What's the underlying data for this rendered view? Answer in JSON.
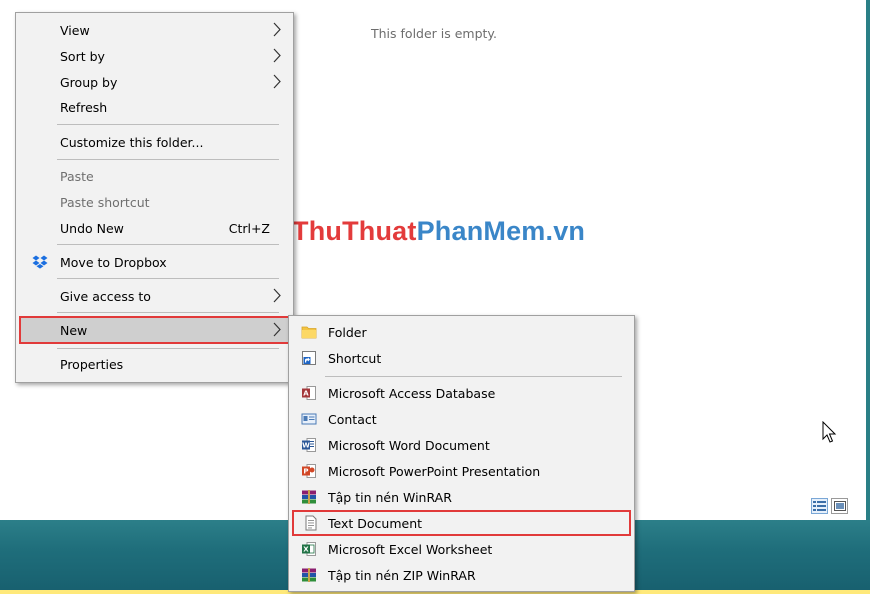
{
  "explorer": {
    "empty_message": "This folder is empty."
  },
  "watermark": {
    "part1": "ThuThuat",
    "part2": "PhanMem",
    "part3": ".vn"
  },
  "context_menu": {
    "items": [
      {
        "label": "View",
        "has_submenu": true
      },
      {
        "label": "Sort by",
        "has_submenu": true
      },
      {
        "label": "Group by",
        "has_submenu": true
      },
      {
        "label": "Refresh"
      },
      {
        "label": "Customize this folder..."
      },
      {
        "label": "Paste",
        "disabled": true
      },
      {
        "label": "Paste shortcut",
        "disabled": true
      },
      {
        "label": "Undo New",
        "shortcut": "Ctrl+Z"
      },
      {
        "label": "Move to Dropbox",
        "icon": "dropbox-icon"
      },
      {
        "label": "Give access to",
        "has_submenu": true
      },
      {
        "label": "New",
        "has_submenu": true,
        "highlighted": true
      },
      {
        "label": "Properties"
      }
    ]
  },
  "new_submenu": {
    "items": [
      {
        "label": "Folder",
        "icon": "folder-icon"
      },
      {
        "label": "Shortcut",
        "icon": "shortcut-icon"
      },
      {
        "label": "Microsoft Access Database",
        "icon": "access-icon"
      },
      {
        "label": "Contact",
        "icon": "contact-icon"
      },
      {
        "label": "Microsoft Word Document",
        "icon": "word-icon"
      },
      {
        "label": "Microsoft PowerPoint Presentation",
        "icon": "powerpoint-icon"
      },
      {
        "label": "Tập tin nén WinRAR",
        "icon": "winrar-icon"
      },
      {
        "label": "Text Document",
        "icon": "text-document-icon",
        "highlighted": true
      },
      {
        "label": "Microsoft Excel Worksheet",
        "icon": "excel-icon"
      },
      {
        "label": "Tập tin nén ZIP WinRAR",
        "icon": "winrar-zip-icon"
      }
    ]
  },
  "colors": {
    "highlight_border": "#e13a3a",
    "watermark_red": "#e33b3b",
    "watermark_blue": "#3a86c8",
    "taskbar": "#1f6e7b"
  }
}
